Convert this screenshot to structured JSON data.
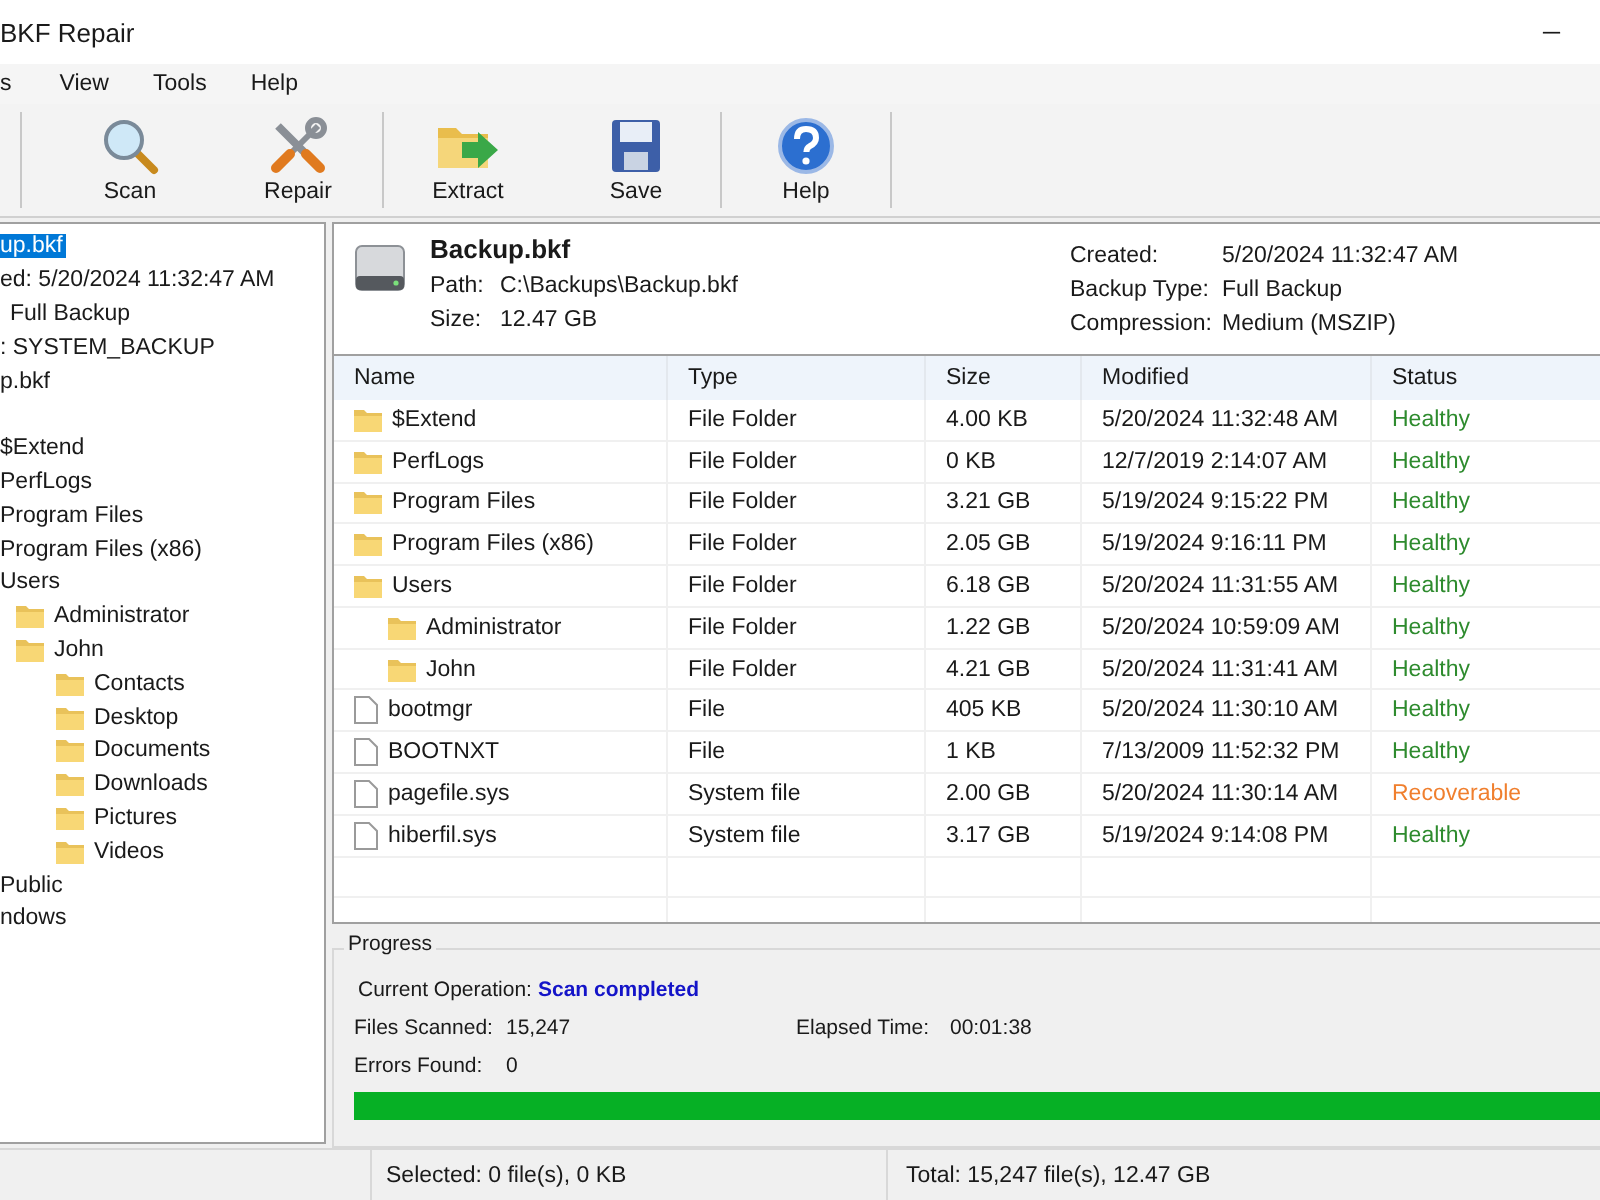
{
  "window": {
    "title": "BKF Repair",
    "controls": [
      "─"
    ]
  },
  "menu": [
    {
      "label": "s"
    },
    {
      "label": "View"
    },
    {
      "label": "Tools"
    },
    {
      "label": "Help"
    }
  ],
  "toolbar": [
    {
      "kind": "scan",
      "label": "Scan"
    },
    {
      "kind": "repair",
      "label": "Repair"
    },
    {
      "kind": "sep"
    },
    {
      "kind": "extract",
      "label": "Extract"
    },
    {
      "kind": "save",
      "label": "Save"
    },
    {
      "kind": "sep"
    },
    {
      "kind": "help",
      "label": "Help"
    },
    {
      "kind": "sep"
    }
  ],
  "tree": [
    {
      "kind": "file",
      "label": "up.bkf",
      "selected": true
    },
    {
      "kind": "info",
      "label": "ed:  5/20/2024 11:32:47 AM"
    },
    {
      "kind": "info",
      "label": "Full Backup",
      "indent": true
    },
    {
      "kind": "info",
      "label": ":  SYSTEM_BACKUP"
    },
    {
      "kind": "file",
      "label": "p.bkf",
      "selected": false
    },
    {
      "kind": "blank"
    },
    {
      "kind": "folder",
      "label": "$Extend",
      "selected": false
    },
    {
      "kind": "folder",
      "label": "PerfLogs",
      "selected": false
    },
    {
      "kind": "folder",
      "label": "Program Files",
      "selected": false
    },
    {
      "kind": "folder",
      "label": "Program Files (x86)",
      "selected": false
    },
    {
      "kind": "folder",
      "label": "Users",
      "selected": false,
      "children": [
        {
          "kind": "folder",
          "label": "Administrator",
          "selected": false
        },
        {
          "kind": "folder",
          "label": "John",
          "selected": false,
          "children": [
            {
              "kind": "folder",
              "label": "Contacts",
              "selected": false
            },
            {
              "kind": "folder",
              "label": "Desktop",
              "selected": false
            },
            {
              "kind": "folder",
              "label": "Documents",
              "selected": false
            },
            {
              "kind": "folder",
              "label": "Downloads",
              "selected": false
            },
            {
              "kind": "folder",
              "label": "Pictures",
              "selected": false
            },
            {
              "kind": "folder",
              "label": "Videos",
              "selected": false
            }
          ]
        }
      ]
    },
    {
      "kind": "folder",
      "label": "Public",
      "selected": false
    },
    {
      "kind": "file",
      "label": "ndows",
      "selected": false
    }
  ],
  "details": {
    "name": "Backup.bkf",
    "left": [
      {
        "label": "Path:",
        "value": "C:\\Backups\\Backup.bkf"
      },
      {
        "label": "Size:",
        "value": "12.47 GB"
      }
    ],
    "right": [
      {
        "label": "Created:",
        "value": "5/20/2024 11:32:47 AM"
      },
      {
        "label": "Backup Type:",
        "value": "Full Backup"
      },
      {
        "label": "Compression:",
        "value": "Medium (MSZIP)"
      }
    ]
  },
  "table": {
    "columns": [
      "Name",
      "Type",
      "Size",
      "Modified",
      "Status"
    ],
    "rows": [
      {
        "kind": "folder",
        "name": "$Extend",
        "type": "File Folder",
        "size": "4.00 KB",
        "modified": "5/20/2024 11:32:48 AM",
        "status": "Healthy",
        "color": "#2e8b2e"
      },
      {
        "kind": "folder",
        "name": "PerfLogs",
        "type": "File Folder",
        "size": "0 KB",
        "modified": "12/7/2019 2:14:07 AM",
        "status": "Healthy",
        "color": "#2e8b2e"
      },
      {
        "kind": "folder",
        "name": "Program Files",
        "type": "File Folder",
        "size": "3.21 GB",
        "modified": "5/19/2024 9:15:22 PM",
        "status": "Healthy",
        "color": "#2e8b2e"
      },
      {
        "kind": "folder",
        "name": "Program Files (x86)",
        "type": "File Folder",
        "size": "2.05 GB",
        "modified": "5/19/2024 9:16:11 PM",
        "status": "Healthy",
        "color": "#2e8b2e"
      },
      {
        "kind": "folder",
        "name": "Users",
        "type": "File Folder",
        "size": "6.18 GB",
        "modified": "5/20/2024 11:31:55 AM",
        "status": "Healthy",
        "color": "#2e8b2e",
        "children": [
          {
            "kind": "folder",
            "name": "Administrator",
            "type": "File Folder",
            "size": "1.22 GB",
            "modified": "5/20/2024 10:59:09 AM",
            "status": "Healthy",
            "color": "#2e8b2e"
          },
          {
            "kind": "folder",
            "name": "John",
            "type": "File Folder",
            "size": "4.21 GB",
            "modified": "5/20/2024 11:31:41 AM",
            "status": "Healthy",
            "color": "#2e8b2e"
          }
        ]
      },
      {
        "kind": "file",
        "name": "bootmgr",
        "type": "File",
        "size": "405 KB",
        "modified": "5/20/2024 11:30:10 AM",
        "status": "Healthy",
        "color": "#2e8b2e"
      },
      {
        "kind": "file",
        "name": "BOOTNXT",
        "type": "File",
        "size": "1 KB",
        "modified": "7/13/2009 11:52:32 PM",
        "status": "Healthy",
        "color": "#2e8b2e"
      },
      {
        "kind": "file",
        "name": "pagefile.sys",
        "type": "System file",
        "size": "2.00 GB",
        "modified": "5/20/2024 11:30:14 AM",
        "status": "Recoverable",
        "color": "#f07f2e"
      },
      {
        "kind": "file",
        "name": "hiberfil.sys",
        "type": "System file",
        "size": "3.17 GB",
        "modified": "5/19/2024 9:14:08 PM",
        "status": "Healthy",
        "color": "#2e8b2e"
      }
    ]
  },
  "progress": {
    "title": "Progress",
    "operation_label": "Current Operation:",
    "operation": "Scan completed",
    "files_label": "Files Scanned:",
    "files": "15,247",
    "elapsed_label": "Elapsed Time:",
    "elapsed": "00:01:38",
    "errors_label": "Errors Found:",
    "errors": "0",
    "level": 1
  },
  "status_bar": [
    "Selected: 0 file(s), 0 KB",
    "Total: 15,247 file(s), 12.47 GB"
  ]
}
